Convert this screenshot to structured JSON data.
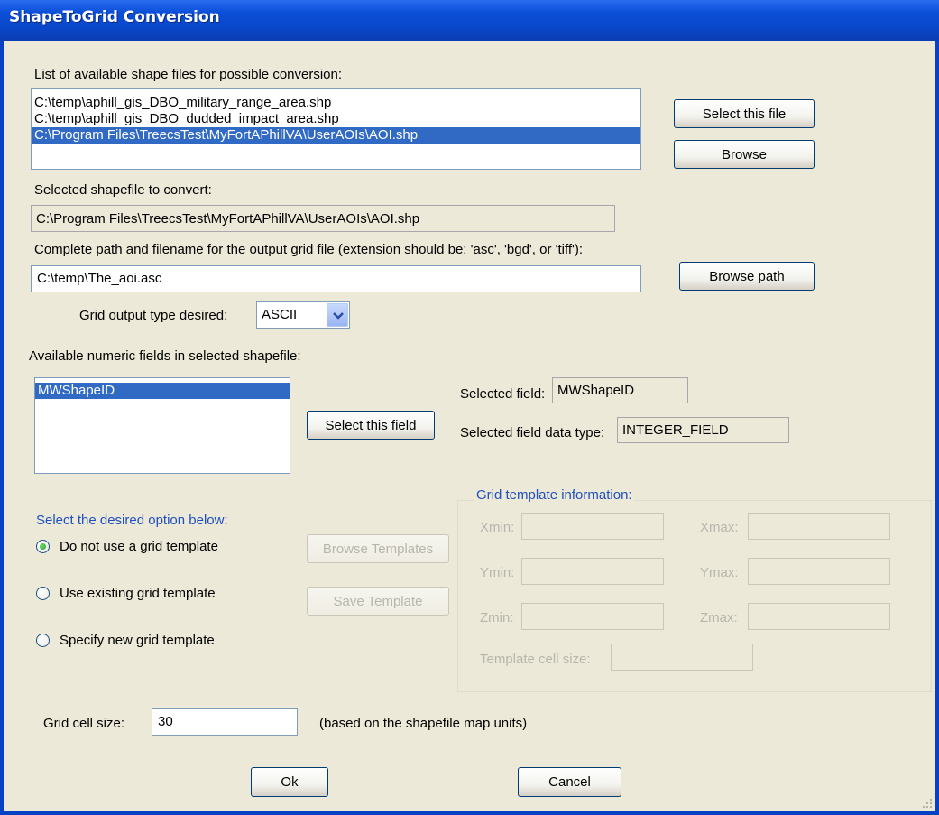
{
  "window": {
    "title": "ShapeToGrid Conversion"
  },
  "shapefiles": {
    "label": "List of available shape files for possible conversion:",
    "items": [
      "C:\\temp\\aphill_gis_DBO_military_range_area.shp",
      "C:\\temp\\aphill_gis_DBO_dudded_impact_area.shp",
      "C:\\Program Files\\TreecsTest\\MyFortAPhillVA\\UserAOIs\\AOI.shp"
    ],
    "selected_index": 2,
    "select_button": "Select this file",
    "browse_button": "Browse"
  },
  "selected_shapefile": {
    "label": "Selected shapefile to convert:",
    "value": "C:\\Program Files\\TreecsTest\\MyFortAPhillVA\\UserAOIs\\AOI.shp"
  },
  "output": {
    "label": "Complete path and filename for the output grid file (extension should be: 'asc', 'bgd', or 'tiff'):",
    "value": "C:\\temp\\The_aoi.asc",
    "browse_button": "Browse path"
  },
  "grid_output_type": {
    "label": "Grid output type desired:",
    "value": "ASCII"
  },
  "numeric_fields": {
    "label": "Available numeric fields in selected shapefile:",
    "items": [
      "MWShapeID"
    ],
    "selected_index": 0,
    "select_button": "Select this field",
    "selected_field_label": "Selected field:",
    "selected_field_value": "MWShapeID",
    "data_type_label": "Selected field data type:",
    "data_type_value": "INTEGER_FIELD"
  },
  "options": {
    "heading": "Select the desired option below:",
    "items": [
      {
        "label": "Do not use a grid template",
        "checked": true
      },
      {
        "label": "Use existing grid template",
        "checked": false
      },
      {
        "label": "Specify new grid template",
        "checked": false
      }
    ],
    "browse_templates": "Browse Templates",
    "save_template": "Save Template"
  },
  "template_info": {
    "heading": "Grid template information:",
    "xmin": "Xmin:",
    "xmax": "Xmax:",
    "ymin": "Ymin:",
    "ymax": "Ymax:",
    "zmin": "Zmin:",
    "zmax": "Zmax:",
    "cell_size": "Template cell size:"
  },
  "grid_cell": {
    "label": "Grid cell size:",
    "value": "30",
    "note": "(based on the shapefile map units)"
  },
  "footer": {
    "ok": "Ok",
    "cancel": "Cancel"
  },
  "icons": {
    "dropdown": "chevron-down-icon",
    "radio": "radio-button-icon",
    "resize": "resize-grip-icon"
  },
  "colors": {
    "titlebar": "#0b4fd8",
    "selection": "#316ac5",
    "dialog_bg": "#ece9d8",
    "heading_blue": "#1f4fbf"
  }
}
